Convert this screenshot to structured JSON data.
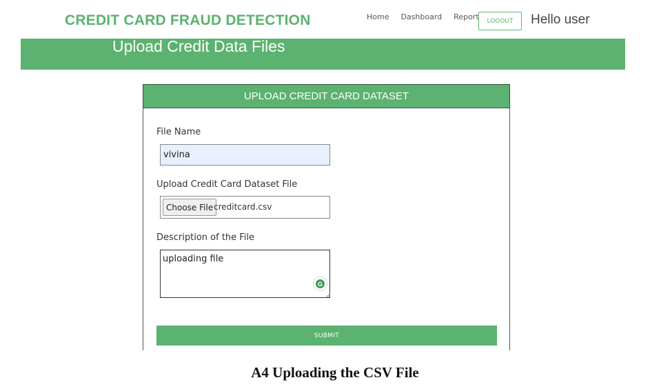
{
  "header": {
    "brand": "CREDIT CARD FRAUD DETECTION",
    "nav": {
      "home": "Home",
      "dashboard": "Dashboard",
      "reports": "Reports",
      "reports_caret_icon": "caret-down-icon"
    },
    "logout_label": "LOGOUT",
    "greeting": "Hello user"
  },
  "banner": {
    "title": "Upload Credit Data Files"
  },
  "form": {
    "card_title": "UPLOAD CREDIT CARD DATASET",
    "file_name_label": "File Name",
    "file_name_value": "vivina",
    "upload_label": "Upload Credit Card Dataset File",
    "choose_file_label": "Choose File",
    "chosen_file": "creditcard.csv",
    "description_label": "Description of the File",
    "description_value": "uploading file",
    "submit_label": "SUBMIT"
  },
  "caption": "A4 Uploading the CSV File",
  "colors": {
    "accent": "#5cb270",
    "card_header_border": "#2f4f38",
    "input_autofill_bg": "#e8f0fe"
  }
}
